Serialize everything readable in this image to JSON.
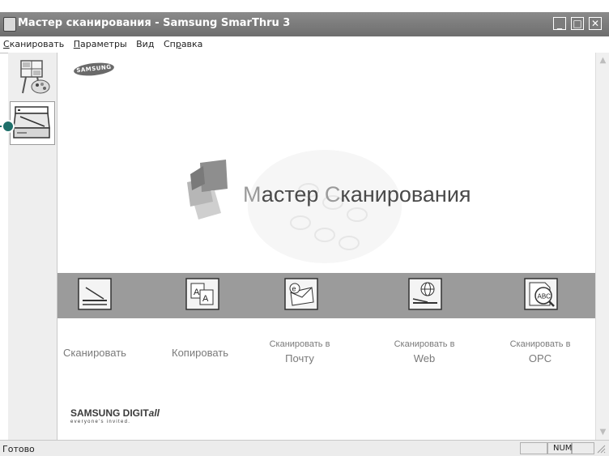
{
  "window": {
    "title": "Мастер сканирования - Samsung SmarThru 3",
    "controls": [
      "_",
      "□",
      "✕"
    ]
  },
  "menu": [
    {
      "label": "Сканировать",
      "mnemonic": "С",
      "rest": "канировать"
    },
    {
      "label": "Параметры",
      "mnemonic": "П",
      "rest": "араметры"
    },
    {
      "label": "Вид",
      "mnemonic": "д",
      "pre": "Ви"
    },
    {
      "label": "Справка",
      "pre": "Сп",
      "mnemonic": "р",
      "rest": "авка"
    }
  ],
  "menu_text": {
    "m0_a": "С",
    "m0_b": "канировать",
    "m1_a": "П",
    "m1_b": "араметры",
    "m2_a": "Ви",
    "m2_b": "д",
    "m3_a": "Сп",
    "m3_b": "р",
    "m3_c": "авка"
  },
  "tools": [
    {
      "icon": "image-manager-icon"
    },
    {
      "icon": "scanner-icon",
      "selected": true
    }
  ],
  "brand": {
    "logo_text": "SAMSUNG",
    "footer_logo": "SAMSUNG DIGIT",
    "footer_logo_italic": "all",
    "footer_tagline": "everyone's invited."
  },
  "hero": {
    "title_first_letter": "М",
    "title_part1": "астер ",
    "title_second_letter": "С",
    "title_part2": "канирования"
  },
  "functions": [
    {
      "label": "Сканировать",
      "icon": "scan-icon"
    },
    {
      "label": "Копировать",
      "icon": "copy-icon"
    },
    {
      "line1": "Сканировать в",
      "line2": "Почту",
      "icon": "scan-to-email-icon"
    },
    {
      "line1": "Сканировать в",
      "line2": "Web",
      "icon": "scan-to-web-icon"
    },
    {
      "line1": "Сканировать в",
      "line2": "OPC",
      "icon": "scan-to-ocr-icon"
    }
  ],
  "status": {
    "text": "Готово",
    "panel_num": "NUM"
  },
  "colors": {
    "titlebar": "#7a7a7a",
    "band": "#9b9b9b",
    "callout": "#1e6f6a",
    "label_gray": "#7a7a7a"
  }
}
